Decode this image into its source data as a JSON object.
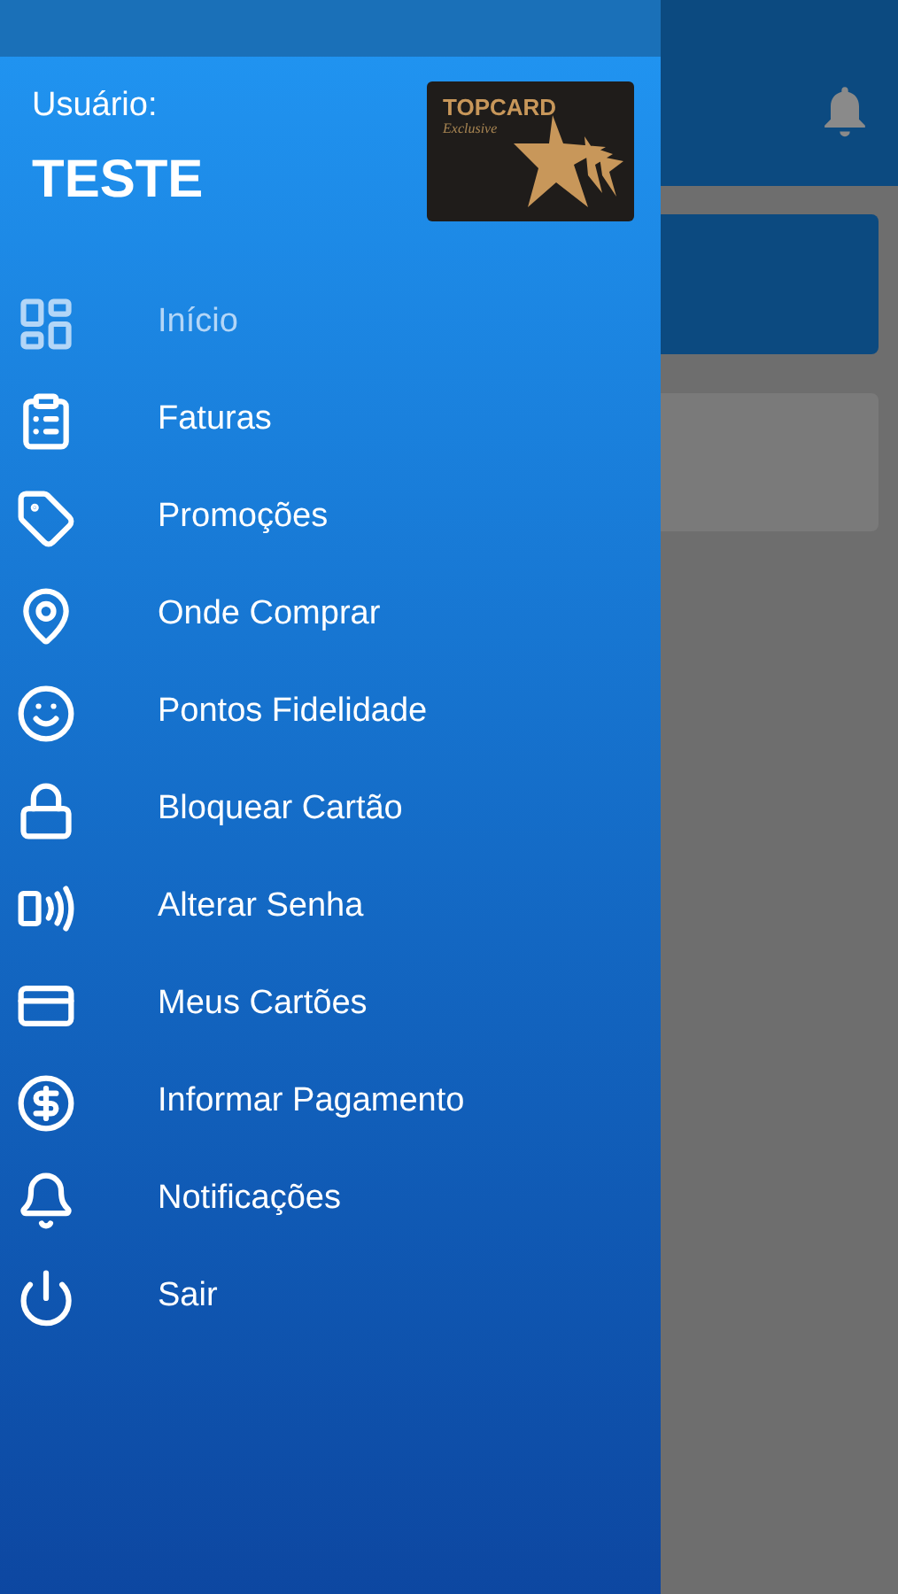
{
  "drawer": {
    "user_label": "Usuário:",
    "user_name": "TESTE",
    "card": {
      "brand": "TOPCARD",
      "tagline": "Exclusive"
    },
    "items": [
      {
        "label": "Início",
        "selected": true
      },
      {
        "label": "Faturas",
        "selected": false
      },
      {
        "label": "Promoções",
        "selected": false
      },
      {
        "label": "Onde Comprar",
        "selected": false
      },
      {
        "label": "Pontos Fidelidade",
        "selected": false
      },
      {
        "label": "Bloquear Cartão",
        "selected": false
      },
      {
        "label": "Alterar Senha",
        "selected": false
      },
      {
        "label": "Meus Cartões",
        "selected": false
      },
      {
        "label": "Informar Pagamento",
        "selected": false
      },
      {
        "label": "Notificações",
        "selected": false
      },
      {
        "label": "Sair",
        "selected": false
      }
    ]
  }
}
